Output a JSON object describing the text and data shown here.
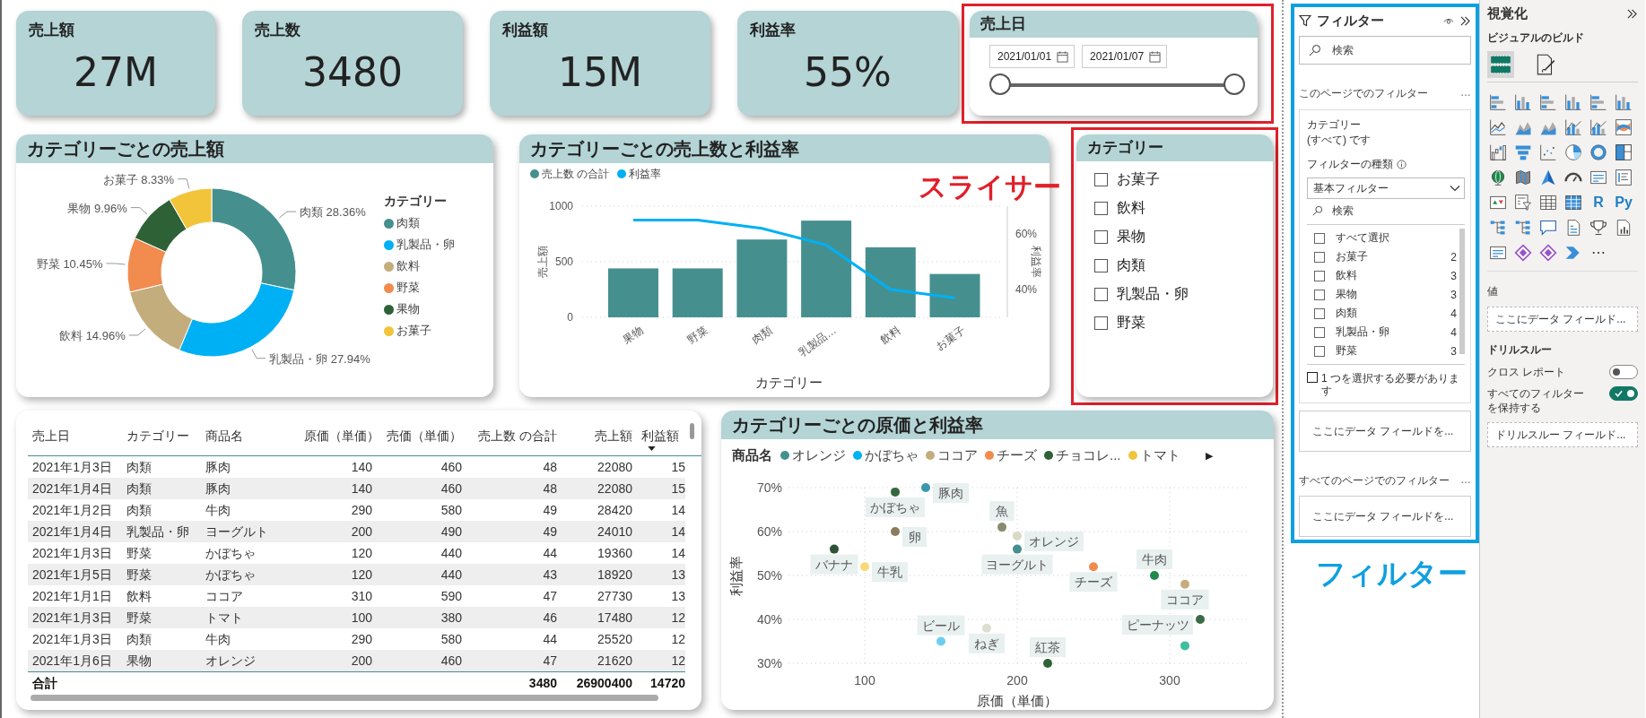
{
  "kpi_cards": [
    {
      "label": "売上額",
      "value": "27M"
    },
    {
      "label": "売上数",
      "value": "3480"
    },
    {
      "label": "利益額",
      "value": "15M"
    },
    {
      "label": "利益率",
      "value": "55%"
    }
  ],
  "date_slicer": {
    "title": "売上日",
    "start": "2021/01/01",
    "end": "2021/01/07",
    "handles": [
      {
        "level": 0
      },
      {
        "level": 1
      }
    ]
  },
  "donut_card": {
    "title": "カテゴリーごとの売上額",
    "legend": {
      "title": "カテゴリー",
      "items": [
        {
          "label": "肉類",
          "color": "#45908f"
        },
        {
          "label": "乳製品・卵",
          "color": "#00b0f5"
        },
        {
          "label": "飲料",
          "color": "#c4ad7c"
        },
        {
          "label": "野菜",
          "color": "#f28b4e"
        },
        {
          "label": "果物",
          "color": "#2e6236"
        },
        {
          "label": "お菓子",
          "color": "#f2c43a"
        }
      ]
    },
    "chart_data": {
      "type": "donut",
      "categories": [
        "肉類",
        "乳製品・卵",
        "飲料",
        "野菜",
        "果物",
        "お菓子"
      ],
      "values": [
        28.36,
        27.94,
        14.96,
        10.45,
        9.96,
        8.33
      ],
      "value_labels": [
        "28.36%",
        "27.94%",
        "14.96%",
        "10.45%",
        "9.96%",
        "8.33%"
      ]
    }
  },
  "combo_card": {
    "title": "カテゴリーごとの売上数と利益率",
    "chart_data": {
      "type": "bar",
      "categories": [
        "果物",
        "野菜",
        "肉類",
        "乳製品…",
        "飲料",
        "お菓子"
      ],
      "xlabel": "カテゴリー",
      "ylabel": "売上額",
      "grid": true,
      "ylim": [
        0,
        1000
      ],
      "yticks": [
        0,
        500,
        1000
      ],
      "series": [
        {
          "name": "売上数 の合計",
          "color": "#45908f",
          "values": [
            440,
            440,
            700,
            870,
            630,
            390
          ]
        }
      ]
    },
    "line_layer": {
      "chart_data": {
        "type": "line",
        "ylabel": "利益率",
        "ylim": [
          0.3,
          0.7
        ],
        "yticks": [
          {
            "value": 0.4,
            "label": "40%"
          },
          {
            "value": 0.6,
            "label": "60%"
          }
        ],
        "series": [
          {
            "name": "利益率",
            "color": "#00b0f5",
            "values": [
              0.65,
              0.65,
              0.62,
              0.56,
              0.4,
              0.37
            ]
          }
        ]
      }
    }
  },
  "category_slicer": {
    "title": "カテゴリー",
    "items": [
      {
        "label": "お菓子",
        "checked": false
      },
      {
        "label": "飲料",
        "checked": false
      },
      {
        "label": "果物",
        "checked": false
      },
      {
        "label": "肉類",
        "checked": false
      },
      {
        "label": "乳製品・卵",
        "checked": false
      },
      {
        "label": "野菜",
        "checked": false
      }
    ]
  },
  "table_card": {
    "columns": [
      {
        "label": "売上日",
        "kind": "text",
        "sorted": false
      },
      {
        "label": "カテゴリー",
        "kind": "text",
        "sorted": false
      },
      {
        "label": "商品名",
        "kind": "text",
        "sorted": false
      },
      {
        "label": "原価（単価）",
        "kind": "number",
        "sorted": false
      },
      {
        "label": "売価（単価）",
        "kind": "number",
        "sorted": false
      },
      {
        "label": "売上数 の合計",
        "kind": "number",
        "sorted": false
      },
      {
        "label": "売上額",
        "kind": "number",
        "sorted": false
      },
      {
        "label": "利益額",
        "kind": "number",
        "sorted": true
      }
    ],
    "rows": [
      [
        "2021年1月3日",
        "肉類",
        "豚肉",
        "140",
        "460",
        "48",
        "22080",
        "15"
      ],
      [
        "2021年1月4日",
        "肉類",
        "豚肉",
        "140",
        "460",
        "48",
        "22080",
        "15"
      ],
      [
        "2021年1月2日",
        "肉類",
        "牛肉",
        "290",
        "580",
        "49",
        "28420",
        "14"
      ],
      [
        "2021年1月4日",
        "乳製品・卵",
        "ヨーグルト",
        "200",
        "490",
        "49",
        "24010",
        "14"
      ],
      [
        "2021年1月3日",
        "野菜",
        "かぼちゃ",
        "120",
        "440",
        "44",
        "19360",
        "14"
      ],
      [
        "2021年1月5日",
        "野菜",
        "かぼちゃ",
        "120",
        "440",
        "43",
        "18920",
        "13"
      ],
      [
        "2021年1月1日",
        "飲料",
        "ココア",
        "310",
        "590",
        "47",
        "27730",
        "13"
      ],
      [
        "2021年1月3日",
        "野菜",
        "トマト",
        "100",
        "380",
        "46",
        "17480",
        "12"
      ],
      [
        "2021年1月3日",
        "肉類",
        "牛肉",
        "290",
        "580",
        "44",
        "25520",
        "12"
      ],
      [
        "2021年1月6日",
        "果物",
        "オレンジ",
        "200",
        "460",
        "47",
        "21620",
        "12"
      ]
    ],
    "total": {
      "label": "合計",
      "values": [
        "3480",
        "26900400",
        "14720"
      ]
    }
  },
  "scatter_card": {
    "title": "カテゴリーごとの原価と利益率",
    "legend": {
      "title": "商品名",
      "items": [
        {
          "name": "オレンジ",
          "color": "#45908f"
        },
        {
          "name": "かぼちゃ",
          "color": "#00b0f5"
        },
        {
          "name": "ココア",
          "color": "#c4ad7c"
        },
        {
          "name": "チーズ",
          "color": "#f28b4e"
        },
        {
          "name": "チョコレ...",
          "color": "#2e6236"
        },
        {
          "name": "トマト",
          "color": "#f2c43a"
        }
      ],
      "more": "▶"
    },
    "chart_data": {
      "type": "scatter",
      "xlabel": "原価（単価）",
      "ylabel": "利益率",
      "xlim": [
        50,
        350
      ],
      "ylim": [
        0.3,
        0.7
      ],
      "grid": true,
      "xticks": [
        {
          "value": 100,
          "label": "100"
        },
        {
          "value": 200,
          "label": "200"
        },
        {
          "value": 300,
          "label": "300"
        }
      ],
      "yticks": [
        {
          "value": 0.3,
          "label": "30%"
        },
        {
          "value": 0.4,
          "label": "40%"
        },
        {
          "value": 0.5,
          "label": "50%"
        },
        {
          "value": 0.6,
          "label": "60%"
        },
        {
          "value": 0.7,
          "label": "70%"
        }
      ],
      "series": [
        {
          "color": "#35683e",
          "x": [
            120
          ],
          "values": [
            0.69
          ],
          "value_labels": [
            "かぼちゃ"
          ]
        },
        {
          "color": "#3a97ae",
          "x": [
            140
          ],
          "values": [
            0.7
          ],
          "value_labels": [
            "豚肉"
          ]
        },
        {
          "color": "#8a8a70",
          "x": [
            190
          ],
          "values": [
            0.61
          ],
          "value_labels": [
            "魚"
          ]
        },
        {
          "color": "#d9d9c6",
          "x": [
            200
          ],
          "values": [
            0.59
          ],
          "value_labels": [
            "オレンジ"
          ]
        },
        {
          "color": "#45908f",
          "x": [
            200
          ],
          "values": [
            0.56
          ],
          "value_labels": [
            "ヨーグルト"
          ]
        },
        {
          "color": "#8b7b5e",
          "x": [
            120
          ],
          "values": [
            0.6
          ],
          "value_labels": [
            "卵"
          ]
        },
        {
          "color": "#2e5236",
          "x": [
            80
          ],
          "values": [
            0.56
          ],
          "value_labels": [
            "バナナ"
          ]
        },
        {
          "color": "#f7d97a",
          "x": [
            100
          ],
          "values": [
            0.52
          ],
          "value_labels": [
            "牛乳"
          ]
        },
        {
          "color": "#f28b4e",
          "x": [
            250
          ],
          "values": [
            0.52
          ],
          "value_labels": [
            "チーズ"
          ]
        },
        {
          "color": "#1f8a4c",
          "x": [
            290
          ],
          "values": [
            0.5
          ],
          "value_labels": [
            "牛肉"
          ]
        },
        {
          "color": "#c4ad7c",
          "x": [
            310
          ],
          "values": [
            0.48
          ],
          "value_labels": [
            "ココア"
          ]
        },
        {
          "color": "#3a6b45",
          "x": [
            320
          ],
          "values": [
            0.4
          ],
          "value_labels": [
            "ピーナッツ"
          ]
        },
        {
          "color": "#3fbf9f",
          "x": [
            310
          ],
          "values": [
            0.34
          ],
          "value_labels": [
            null
          ]
        },
        {
          "color": "#6ccff0",
          "x": [
            150
          ],
          "values": [
            0.35
          ],
          "value_labels": [
            "ビール"
          ]
        },
        {
          "color": "#deded0",
          "x": [
            180
          ],
          "values": [
            0.38
          ],
          "value_labels": [
            "ねぎ"
          ]
        },
        {
          "color": "#2e6236",
          "x": [
            220
          ],
          "values": [
            0.3
          ],
          "value_labels": [
            "紅茶"
          ]
        }
      ]
    }
  },
  "annotations": {
    "slicer_label": "スライサー",
    "filter_label": "フィルター"
  },
  "filter_pane": {
    "title": "フィルター",
    "search_placeholder": "検索",
    "page_section": "このページでのフィルター",
    "page_more": "…",
    "filter_card": {
      "field": "カテゴリー",
      "summary": "(すべて) です",
      "type_label": "フィルターの種類",
      "type_value": "基本フィルター",
      "search_placeholder": "検索",
      "items": [
        {
          "label": "すべて選択",
          "checked": false
        },
        {
          "label": "お菓子",
          "count": "2",
          "checked": false
        },
        {
          "label": "飲料",
          "count": "3",
          "checked": false
        },
        {
          "label": "果物",
          "count": "3",
          "checked": false
        },
        {
          "label": "肉類",
          "count": "4",
          "checked": false
        },
        {
          "label": "乳製品・卵",
          "count": "4",
          "checked": false
        },
        {
          "label": "野菜",
          "count": "3",
          "checked": false
        }
      ],
      "require_one": {
        "label": "1 つを選択する必要があります",
        "checked": false
      }
    },
    "page_drop": "ここにデータ フィールドを...",
    "all_section": "すべてのページでのフィルター",
    "all_more": "…",
    "all_drop": "ここにデータ フィールドを..."
  },
  "visualizations_pane": {
    "title": "視覚化",
    "subtitle": "ビジュアルのビルド",
    "build_tabs": [
      {
        "kind": "fields",
        "selected": true
      },
      {
        "kind": "format",
        "selected": false
      }
    ],
    "visual_types": [
      {
        "kind": "barh"
      },
      {
        "kind": "col"
      },
      {
        "kind": "barh"
      },
      {
        "kind": "col"
      },
      {
        "kind": "barh"
      },
      {
        "kind": "col"
      },
      {
        "kind": "line"
      },
      {
        "kind": "area"
      },
      {
        "kind": "area"
      },
      {
        "kind": "combo"
      },
      {
        "kind": "combo"
      },
      {
        "kind": "ribbon"
      },
      {
        "kind": "waterfall"
      },
      {
        "kind": "funnel"
      },
      {
        "kind": "scatter"
      },
      {
        "kind": "pie"
      },
      {
        "kind": "donut"
      },
      {
        "kind": "treemap"
      },
      {
        "kind": "globe"
      },
      {
        "kind": "map"
      },
      {
        "kind": "nav"
      },
      {
        "kind": "gauge"
      },
      {
        "kind": "card"
      },
      {
        "kind": "list"
      },
      {
        "kind": "kpi"
      },
      {
        "kind": "slicer"
      },
      {
        "kind": "table"
      },
      {
        "kind": "matrix"
      },
      {
        "kind": "glyph",
        "glyph": "R"
      },
      {
        "kind": "glyph",
        "glyph": "Py"
      },
      {
        "kind": "tree"
      },
      {
        "kind": "tree"
      },
      {
        "kind": "bubble"
      },
      {
        "kind": "doc"
      },
      {
        "kind": "trophy"
      },
      {
        "kind": "report"
      },
      {
        "kind": "card"
      },
      {
        "kind": "apps"
      },
      {
        "kind": "apps"
      },
      {
        "kind": "flow"
      },
      {
        "kind": "more",
        "glyph": "⋯"
      }
    ],
    "values_label": "値",
    "values_drop": "ここにデータ フィールド...",
    "drill_title": "ドリルスルー",
    "toggles": [
      {
        "label": "クロス レポート",
        "on": false
      },
      {
        "label": "すべてのフィルターを保持する",
        "on": true
      }
    ],
    "drill_drop": "ドリルスルー フィールド..."
  }
}
